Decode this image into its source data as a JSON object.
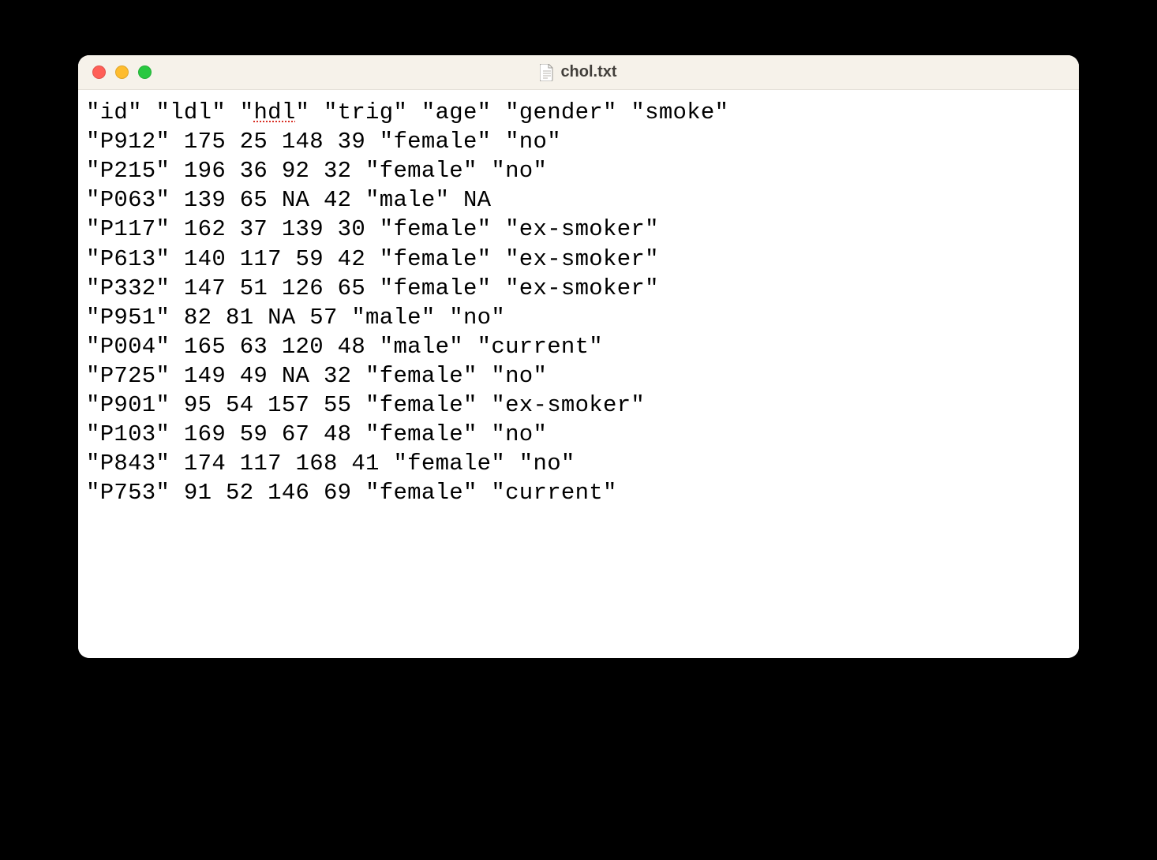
{
  "window": {
    "title": "chol.txt"
  },
  "file": {
    "header_prefix": "\"id\" \"ldl\" \"",
    "header_spellerr": "hdl",
    "header_suffix": "\" \"trig\" \"age\" \"gender\" \"smoke\"",
    "lines": [
      "\"P912\" 175 25 148 39 \"female\" \"no\"",
      "\"P215\" 196 36 92 32 \"female\" \"no\"",
      "\"P063\" 139 65 NA 42 \"male\" NA",
      "\"P117\" 162 37 139 30 \"female\" \"ex-smoker\"",
      "\"P613\" 140 117 59 42 \"female\" \"ex-smoker\"",
      "\"P332\" 147 51 126 65 \"female\" \"ex-smoker\"",
      "\"P951\" 82 81 NA 57 \"male\" \"no\"",
      "\"P004\" 165 63 120 48 \"male\" \"current\"",
      "\"P725\" 149 49 NA 32 \"female\" \"no\"",
      "\"P901\" 95 54 157 55 \"female\" \"ex-smoker\"",
      "\"P103\" 169 59 67 48 \"female\" \"no\"",
      "\"P843\" 174 117 168 41 \"female\" \"no\"",
      "\"P753\" 91 52 146 69 \"female\" \"current\""
    ]
  }
}
